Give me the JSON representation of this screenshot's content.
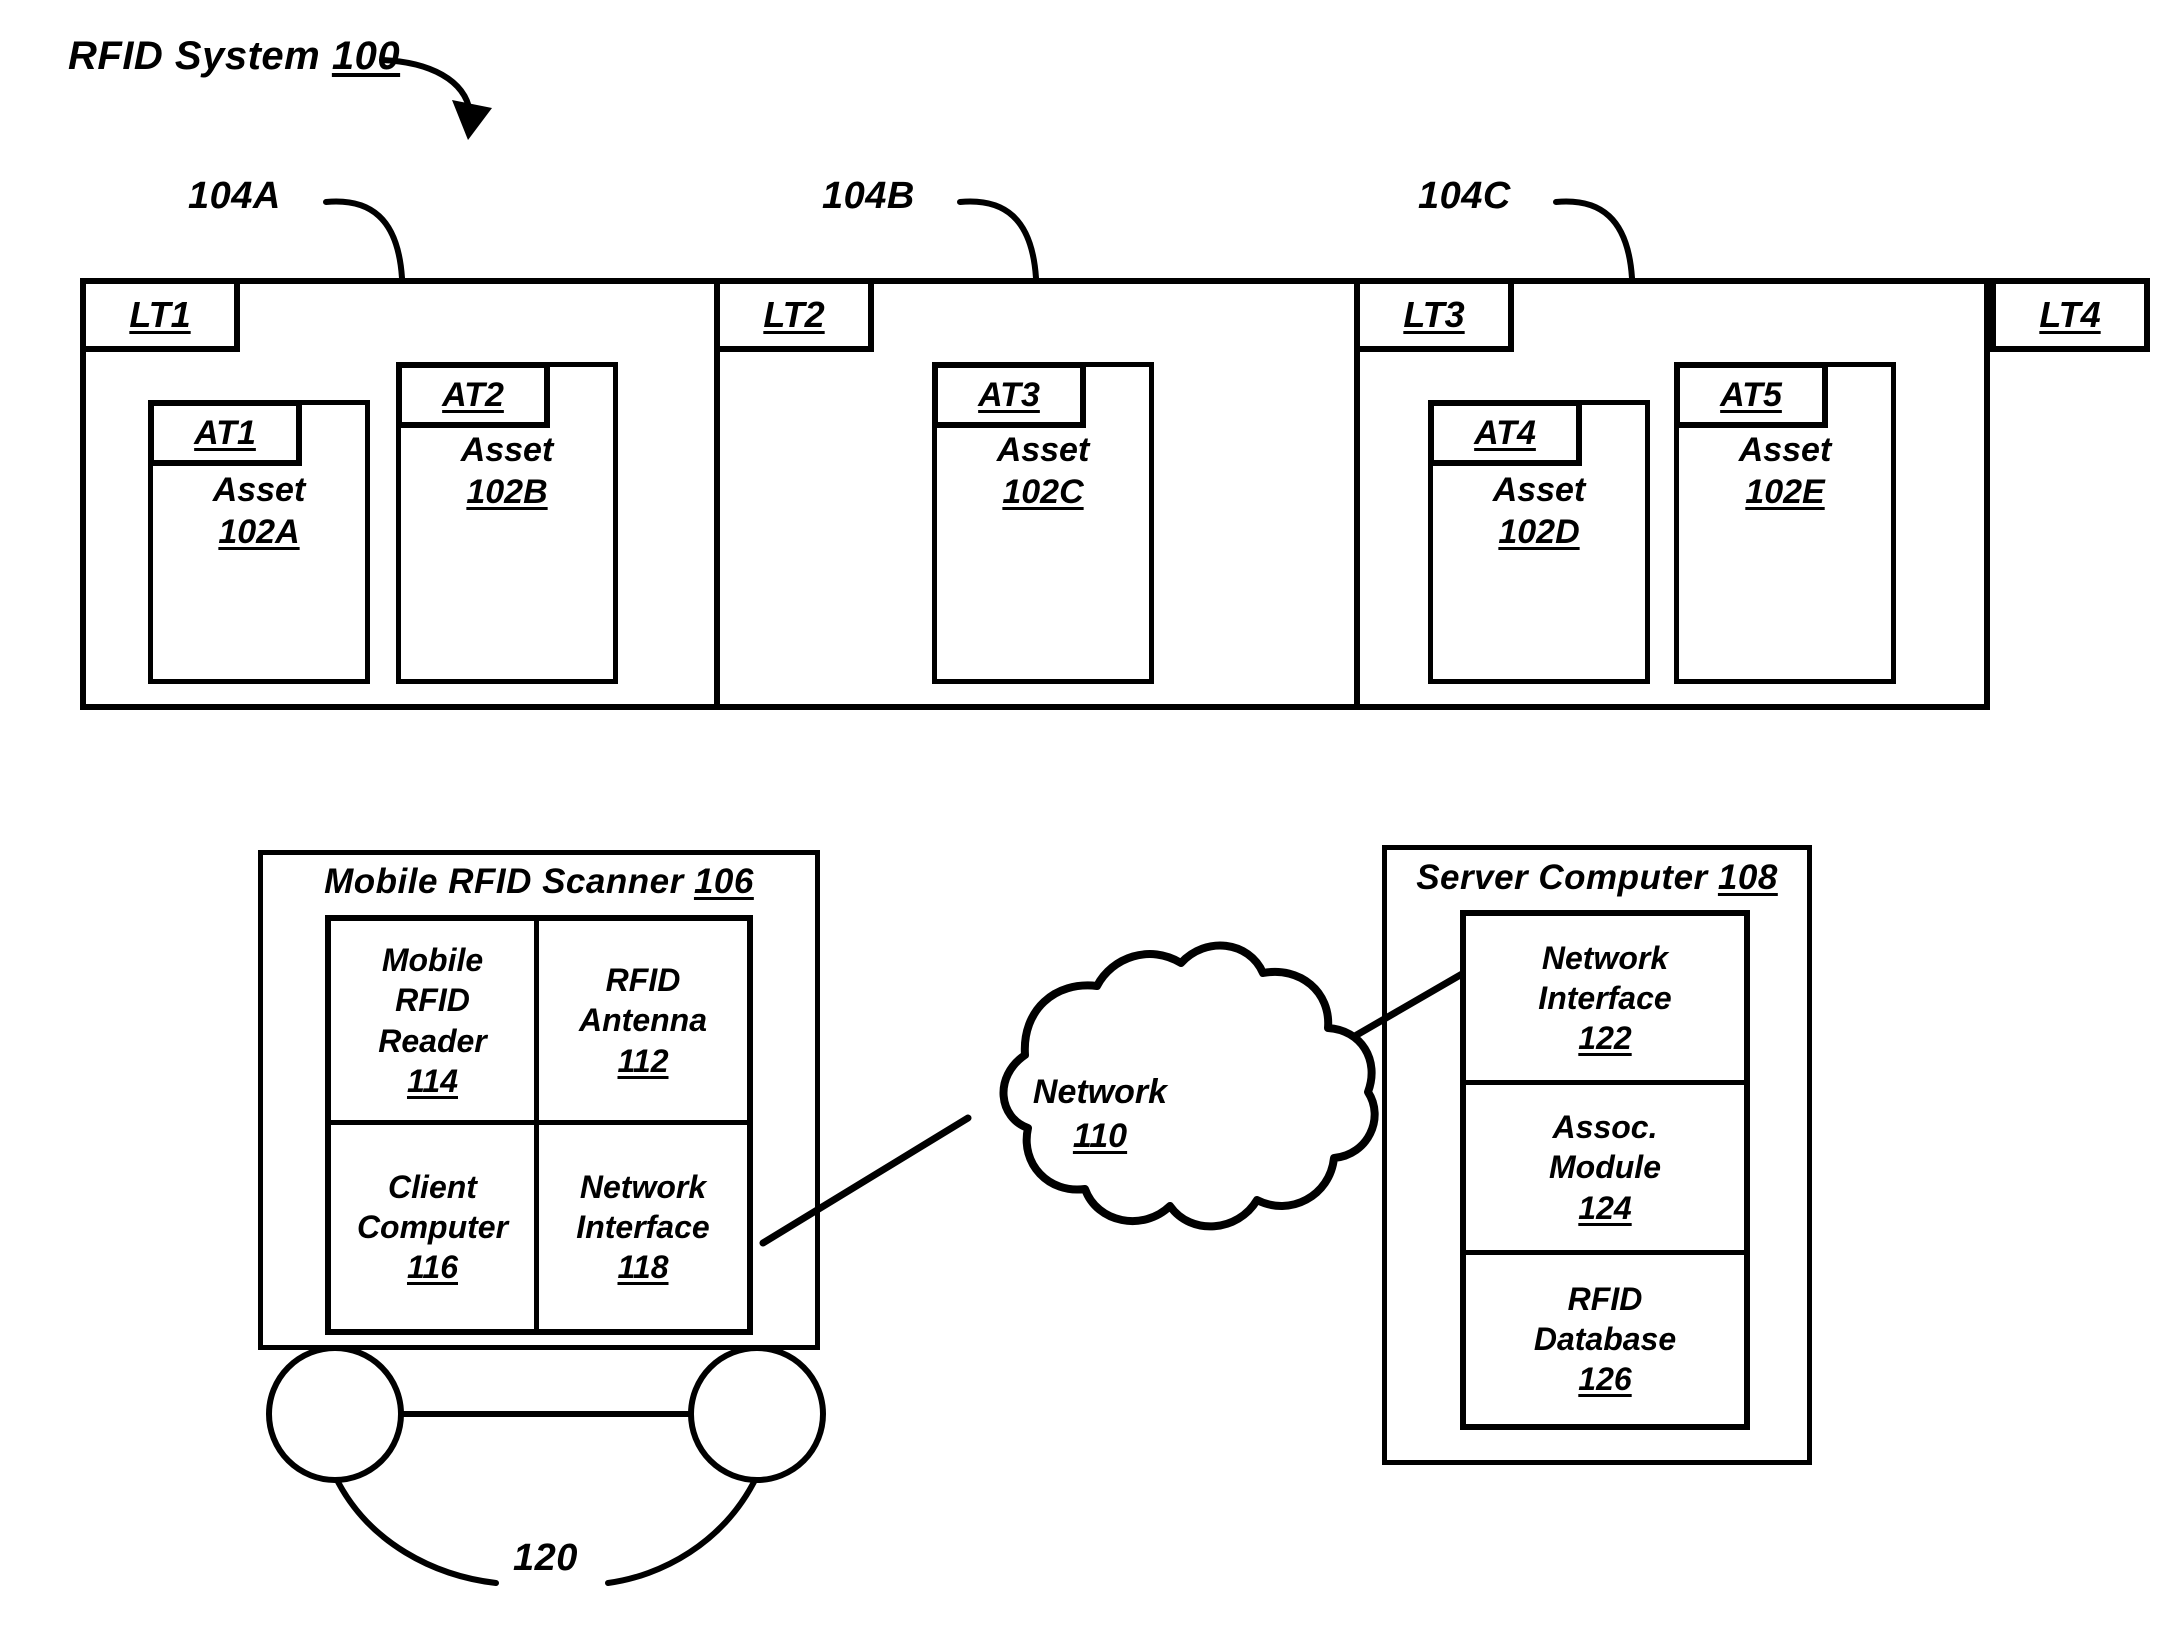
{
  "figure": {
    "title_text": "RFID System",
    "title_ref": "100"
  },
  "locations": {
    "refs": [
      {
        "label": "104A"
      },
      {
        "label": "104B"
      },
      {
        "label": "104C"
      }
    ],
    "tags": [
      {
        "label": "LT1"
      },
      {
        "label": "LT2"
      },
      {
        "label": "LT3"
      },
      {
        "label": "LT4"
      }
    ]
  },
  "assets": [
    {
      "tag": "AT1",
      "name": "Asset",
      "ref": "102A"
    },
    {
      "tag": "AT2",
      "name": "Asset",
      "ref": "102B"
    },
    {
      "tag": "AT3",
      "name": "Asset",
      "ref": "102C"
    },
    {
      "tag": "AT4",
      "name": "Asset",
      "ref": "102D"
    },
    {
      "tag": "AT5",
      "name": "Asset",
      "ref": "102E"
    }
  ],
  "scanner": {
    "title_text": "Mobile RFID Scanner",
    "title_ref": "106",
    "cells": [
      {
        "name": "Mobile\nRFID\nReader",
        "line1": "Mobile",
        "line2": "RFID",
        "line3": "Reader",
        "ref": "114"
      },
      {
        "name": "RFID Antenna",
        "line1": "RFID",
        "line2": "Antenna",
        "line3": "",
        "ref": "112"
      },
      {
        "name": "Client Computer",
        "line1": "Client",
        "line2": "Computer",
        "line3": "",
        "ref": "116"
      },
      {
        "name": "Network Interface",
        "line1": "Network",
        "line2": "Interface",
        "line3": "",
        "ref": "118"
      }
    ],
    "wheels_ref": "120"
  },
  "network": {
    "label": "Network",
    "ref": "110"
  },
  "server": {
    "title_text": "Server Computer",
    "title_ref": "108",
    "cells": [
      {
        "line1": "Network",
        "line2": "Interface",
        "ref": "122"
      },
      {
        "line1": "Assoc.",
        "line2": "Module",
        "ref": "124"
      },
      {
        "line1": "RFID",
        "line2": "Database",
        "ref": "126"
      }
    ]
  },
  "colors": {
    "ink": "#000000",
    "paper": "#ffffff"
  }
}
